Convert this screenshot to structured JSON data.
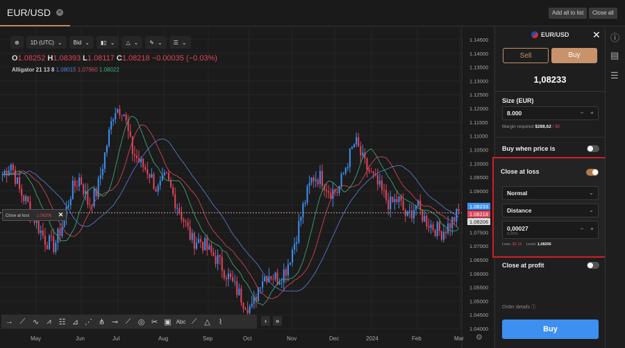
{
  "tab": {
    "title": "EUR/USD"
  },
  "top_buttons": {
    "add_all": "Add all to list",
    "close_all": "Close all"
  },
  "toolbar": {
    "timeframe": "1D (UTC)",
    "price_type": "Bid"
  },
  "ohlc": {
    "o_label": "O",
    "o": "1.08252",
    "h_label": "H",
    "h": "1.08393",
    "l_label": "L",
    "l": "1.08117",
    "c_label": "C",
    "c": "1.08218",
    "change": "−0.00035 (−0.03%)"
  },
  "alligator": {
    "label": "Alligator 21 13 8",
    "jaw": "1.08015",
    "teeth": "1.07960",
    "lips": "1.08022"
  },
  "close_at_loss_tag": {
    "label": "Close at loss",
    "value": "1.08206"
  },
  "price_labels": {
    "ask": "1.08233",
    "bid": "1.08218",
    "loss": "1.08206"
  },
  "colors": {
    "up": "#3d8ff0",
    "down": "#e0445a",
    "jaw": "#5b7fd8",
    "teeth": "#d9485c",
    "lips": "#3fae7a",
    "accent": "#c8926a",
    "buy": "#3d8ff0",
    "highlight": "#d11f25"
  },
  "chart_data": {
    "type": "candlestick",
    "yticks": [
      "1.14500",
      "1.14000",
      "1.13500",
      "1.13000",
      "1.12500",
      "1.12000",
      "1.11500",
      "1.11000",
      "1.10500",
      "1.10000",
      "1.09500",
      "1.09000",
      "1.08500",
      "1.08000",
      "1.07500",
      "1.07000",
      "1.06500",
      "1.06000",
      "1.05500",
      "1.05000",
      "1.04500",
      "1.04000"
    ],
    "ylim": [
      1.04,
      1.145
    ],
    "xticks": [
      "May",
      "Jun",
      "Jul",
      "Aug",
      "Sep",
      "Oct",
      "Nov",
      "Dec",
      "2024",
      "Feb",
      "Mar"
    ],
    "close_keypoints": [
      1.096,
      1.1,
      1.09,
      1.085,
      1.078,
      1.072,
      1.07,
      1.078,
      1.09,
      1.095,
      1.085,
      1.09,
      1.105,
      1.12,
      1.12,
      1.105,
      1.1,
      1.097,
      1.09,
      1.095,
      1.087,
      1.08,
      1.072,
      1.072,
      1.068,
      1.065,
      1.06,
      1.055,
      1.05,
      1.047,
      1.058,
      1.06,
      1.058,
      1.062,
      1.072,
      1.085,
      1.095,
      1.095,
      1.09,
      1.09,
      1.1,
      1.108,
      1.1,
      1.095,
      1.09,
      1.085,
      1.087,
      1.08,
      1.085,
      1.08,
      1.077,
      1.075,
      1.078,
      1.082
    ]
  },
  "panel": {
    "symbol": "EUR/USD",
    "sell": "Sell",
    "buy": "Buy",
    "price": "1,08233",
    "size_label": "Size (EUR)",
    "size": "8.000",
    "margin_label": "Margin required",
    "margin": "$288,62",
    "margin_extra": "/ $0",
    "buy_when": "Buy when price is",
    "close_loss": "Close at loss",
    "mode": "Normal",
    "type": "Distance",
    "distance": "0,00027",
    "distance_pct": "0,02%",
    "loss_label": "Loss:",
    "loss": "$2,16",
    "level_label": "Level:",
    "level": "1,08206",
    "close_profit": "Close at profit",
    "order_details": "Order details",
    "buy_button": "Buy"
  }
}
